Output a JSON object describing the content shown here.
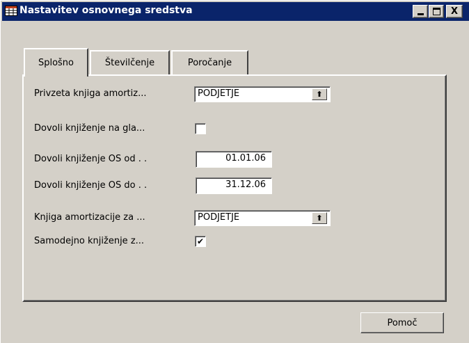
{
  "window": {
    "title": "Nastavitev osnovnega sredstva",
    "icon": "form-table-icon",
    "title_bar_color": "#0a246a",
    "controls": {
      "minimize": "minimize-icon",
      "maximize": "maximize-icon",
      "close": "X"
    }
  },
  "tabs": [
    {
      "label": "Splošno",
      "active": true
    },
    {
      "label": "Številčenje",
      "active": false
    },
    {
      "label": "Poročanje",
      "active": false
    }
  ],
  "fields": {
    "default_depr_book": {
      "label": "Privzeta knjiga amortiz...",
      "value": "PODJETJE"
    },
    "allow_posting_main_assets": {
      "label": "Dovoli knjiženje na gla...",
      "checked": false
    },
    "allow_posting_from": {
      "label": "Dovoli knjiženje OS od . .",
      "value": "01.01.06"
    },
    "allow_posting_to": {
      "label": "Dovoli knjiženje OS do . .",
      "value": "31.12.06"
    },
    "insurance_depr_book": {
      "label": "Knjiga amortizacije za ...",
      "value": "PODJETJE"
    },
    "automatic_insurance_posting": {
      "label": "Samodejno knjiženje z...",
      "checked": true
    }
  },
  "footer": {
    "help_label": "Pomoč"
  },
  "glyphs": {
    "dropdown": "⬆",
    "check": "✔"
  }
}
